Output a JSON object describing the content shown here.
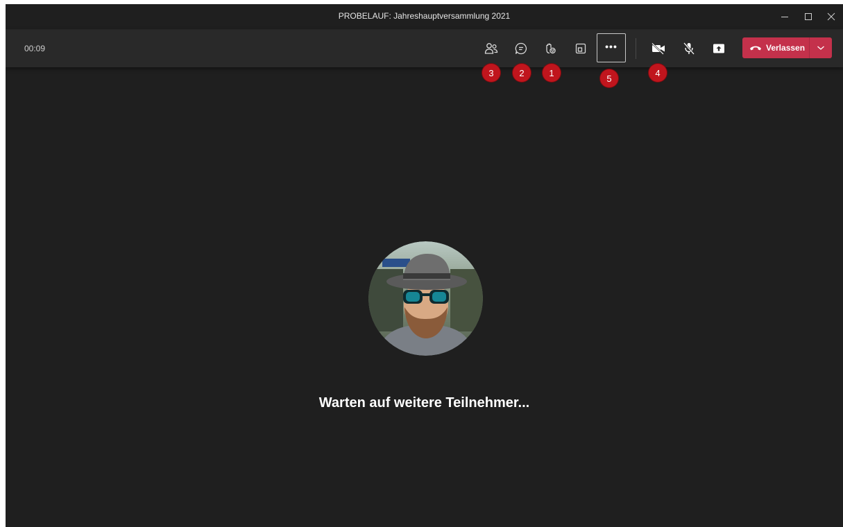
{
  "window": {
    "title": "PROBELAUF: Jahreshauptversammlung 2021",
    "controls": [
      "minimize-icon",
      "maximize-icon",
      "close-icon"
    ]
  },
  "toolbar": {
    "timer": "00:09",
    "buttons": [
      {
        "name": "participants",
        "icon": "people-icon"
      },
      {
        "name": "chat",
        "icon": "chat-bubble-icon"
      },
      {
        "name": "raise-hand",
        "icon": "hand-reaction-icon"
      },
      {
        "name": "rooms",
        "icon": "breakout-rooms-icon"
      },
      {
        "name": "more-actions",
        "icon": "more-dots-icon",
        "label": "•••"
      },
      {
        "name": "camera",
        "icon": "camera-off-icon"
      },
      {
        "name": "microphone",
        "icon": "mic-off-icon"
      },
      {
        "name": "share",
        "icon": "share-tray-icon"
      }
    ],
    "leave": {
      "label": "Verlassen",
      "icon": "hang-up-phone-icon",
      "dropdown_icon": "chevron-down-icon"
    }
  },
  "markers": {
    "participants": "3",
    "chat": "2",
    "raise_hand": "1",
    "more": "5",
    "camera": "4"
  },
  "stage": {
    "waiting_text": "Warten auf weitere Teilnehmer..."
  },
  "colors": {
    "background": "#1f1f1f",
    "toolbar": "#292929",
    "leave_button": "#c4314b",
    "marker": "#c0151d"
  }
}
